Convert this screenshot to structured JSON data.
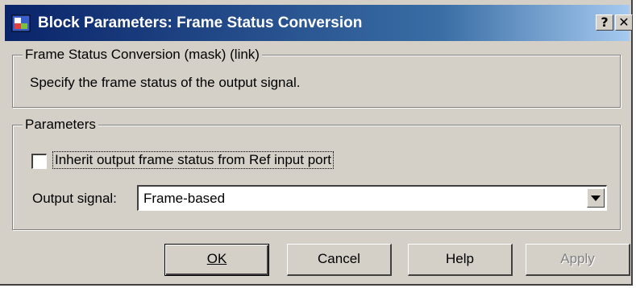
{
  "window": {
    "title": "Block Parameters: Frame Status Conversion",
    "help_button": "?",
    "close_button": "✕"
  },
  "description_group": {
    "legend": "Frame Status Conversion (mask) (link)",
    "text": "Specify the frame status of the output signal."
  },
  "parameters_group": {
    "legend": "Parameters",
    "inherit_checkbox": {
      "label": "Inherit output frame status from Ref input port",
      "checked": false
    },
    "output_signal": {
      "label": "Output signal:",
      "value": "Frame-based"
    }
  },
  "buttons": {
    "ok": "OK",
    "cancel": "Cancel",
    "help": "Help",
    "apply": "Apply"
  },
  "icons": {
    "app": "simulink-block-icon",
    "dropdown": "chevron-down-icon"
  }
}
